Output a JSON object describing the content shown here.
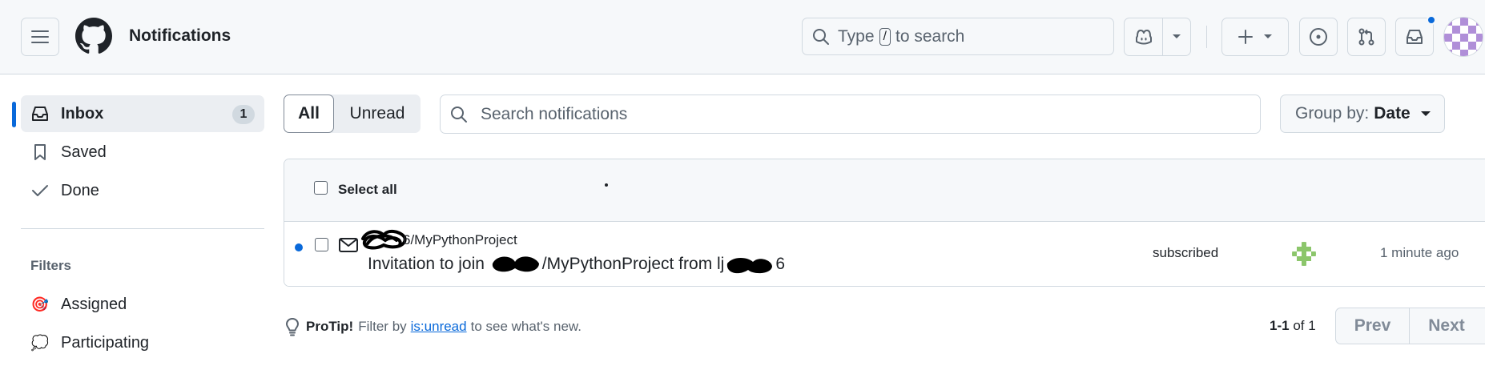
{
  "header": {
    "title": "Notifications",
    "search": {
      "prefix": "Type",
      "key": "/",
      "suffix": "to search"
    }
  },
  "sidebar": {
    "inbox": {
      "label": "Inbox",
      "count": "1"
    },
    "saved": {
      "label": "Saved"
    },
    "done": {
      "label": "Done"
    },
    "filters_heading": "Filters",
    "filters": [
      {
        "label": "Assigned",
        "icon": "target-emoji"
      },
      {
        "label": "Participating",
        "icon": "speech-bubble-emoji"
      }
    ]
  },
  "toolbar": {
    "segment": {
      "all": "All",
      "unread": "Unread"
    },
    "search_placeholder": "Search notifications",
    "group_by": {
      "label": "Group by:",
      "value": "Date"
    }
  },
  "list": {
    "select_all": "Select all",
    "rows": [
      {
        "repo": "6/MyPythonProject",
        "title_prefix": "Invitation to join",
        "title_mid": "/MyPythonProject from lj",
        "title_end": "6",
        "reason": "subscribed",
        "time": "1 minute ago"
      }
    ]
  },
  "footer": {
    "protip_label": "ProTip!",
    "protip_pre": "Filter by",
    "protip_link": "is:unread",
    "protip_post": "to see what's new.",
    "range": "1-1",
    "range_of": "of 1",
    "prev": "Prev",
    "next": "Next"
  },
  "colors": {
    "accent": "#0969da",
    "header_bg": "#f6f8fa",
    "border": "#d1d9e0"
  }
}
